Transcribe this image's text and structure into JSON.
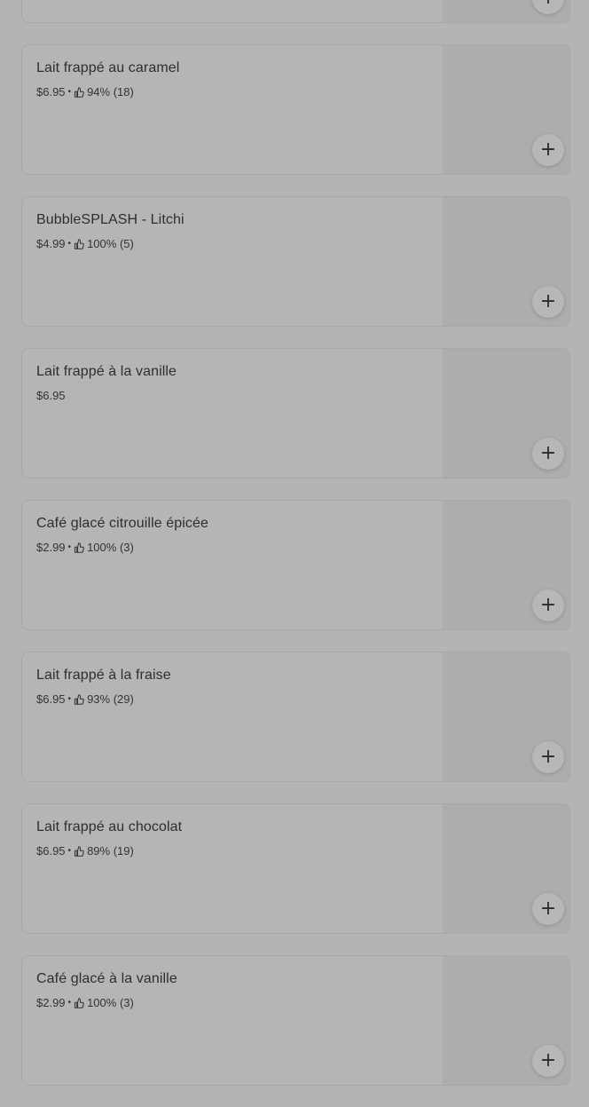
{
  "menu": {
    "items": [
      {
        "name": "",
        "price": "",
        "rating": "",
        "reviews": "",
        "add_icon": "+"
      },
      {
        "name": "Lait frappé au caramel",
        "price": "$6.95",
        "rating": "94%",
        "reviews": "(18)",
        "add_icon": "+"
      },
      {
        "name": "BubbleSPLASH - Litchi",
        "price": "$4.99",
        "rating": "100%",
        "reviews": "(5)",
        "add_icon": "+"
      },
      {
        "name": "Lait frappé à la vanille",
        "price": "$6.95",
        "rating": "",
        "reviews": "",
        "add_icon": "+"
      },
      {
        "name": "Café glacé citrouille épicée",
        "price": "$2.99",
        "rating": "100%",
        "reviews": "(3)",
        "add_icon": "+"
      },
      {
        "name": "Lait frappé à la fraise",
        "price": "$6.95",
        "rating": "93%",
        "reviews": "(29)",
        "add_icon": "+"
      },
      {
        "name": "Lait frappé au chocolat",
        "price": "$6.95",
        "rating": "89%",
        "reviews": "(19)",
        "add_icon": "+"
      },
      {
        "name": "Café glacé à la vanille",
        "price": "$2.99",
        "rating": "100%",
        "reviews": "(3)",
        "add_icon": "+"
      }
    ],
    "separator": "•",
    "icons": {
      "rating": "thumbs-up-icon",
      "add": "plus-icon"
    }
  }
}
